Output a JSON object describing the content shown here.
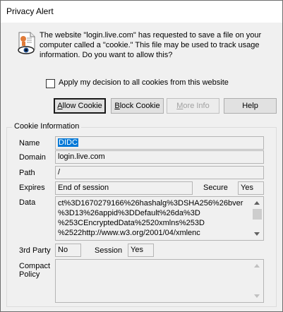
{
  "window": {
    "title": "Privacy Alert"
  },
  "icons": {
    "alert": "cookie-eye-icon"
  },
  "message": "The website \"login.live.com\" has requested to save a file on your computer called a \"cookie.\" This file may be used to track usage information. Do you want to allow this?",
  "checkbox": {
    "label": "Apply my decision to all cookies from this website",
    "checked": false
  },
  "buttons": {
    "allow": {
      "pre": "",
      "key": "A",
      "post": "llow Cookie"
    },
    "block": {
      "pre": "",
      "key": "B",
      "post": "lock Cookie"
    },
    "more": {
      "pre": "",
      "key": "M",
      "post": "ore Info"
    },
    "help": {
      "label": "Help"
    }
  },
  "cookie": {
    "group_title": "Cookie Information",
    "name_label": "Name",
    "name_value": "DIDC",
    "domain_label": "Domain",
    "domain_value": "login.live.com",
    "path_label": "Path",
    "path_value": "/",
    "expires_label": "Expires",
    "expires_value": "End of session",
    "secure_label": "Secure",
    "secure_value": "Yes",
    "data_label": "Data",
    "data_lines": [
      "ct%3D1670279166%26hashalg%3DSHA256%26bver",
      "%3D13%26appid%3DDefault%26da%3D",
      "%253CEncryptedData%2520xmlns%253D",
      "%2522http://www.w3.org/2001/04/xmlenc"
    ],
    "third_party_label": "3rd Party",
    "third_party_value": "No",
    "session_label": "Session",
    "session_value": "Yes",
    "compact_policy_label_1": "Compact",
    "compact_policy_label_2": "Policy",
    "compact_policy_value": ""
  },
  "colors": {
    "selection": "#0078d7",
    "dialog_bg": "#f0f0f0"
  }
}
